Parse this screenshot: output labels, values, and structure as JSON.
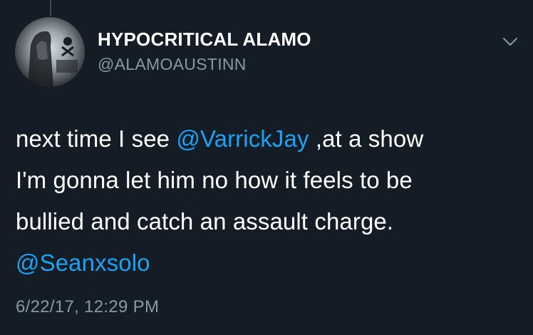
{
  "tweet": {
    "display_name": "HYPOCRITICAL ALAMO",
    "handle": "@ALAMOAUSTINN",
    "line1_text": "next time I see ",
    "mention1": "@VarrickJay",
    "line1_rest": " ,at a show",
    "line2": "I'm gonna let him no how it feels to be",
    "line3": "bullied and catch an assault charge.",
    "mention2": "@Seanxsolo",
    "timestamp": "6/22/17, 12:29 PM"
  },
  "icons": {
    "menu": "chevron-down-icon",
    "avatar": "avatar-image"
  },
  "colors": {
    "background": "#141d26",
    "text": "#ffffff",
    "secondary": "#8899a6",
    "link": "#1da1f2"
  }
}
